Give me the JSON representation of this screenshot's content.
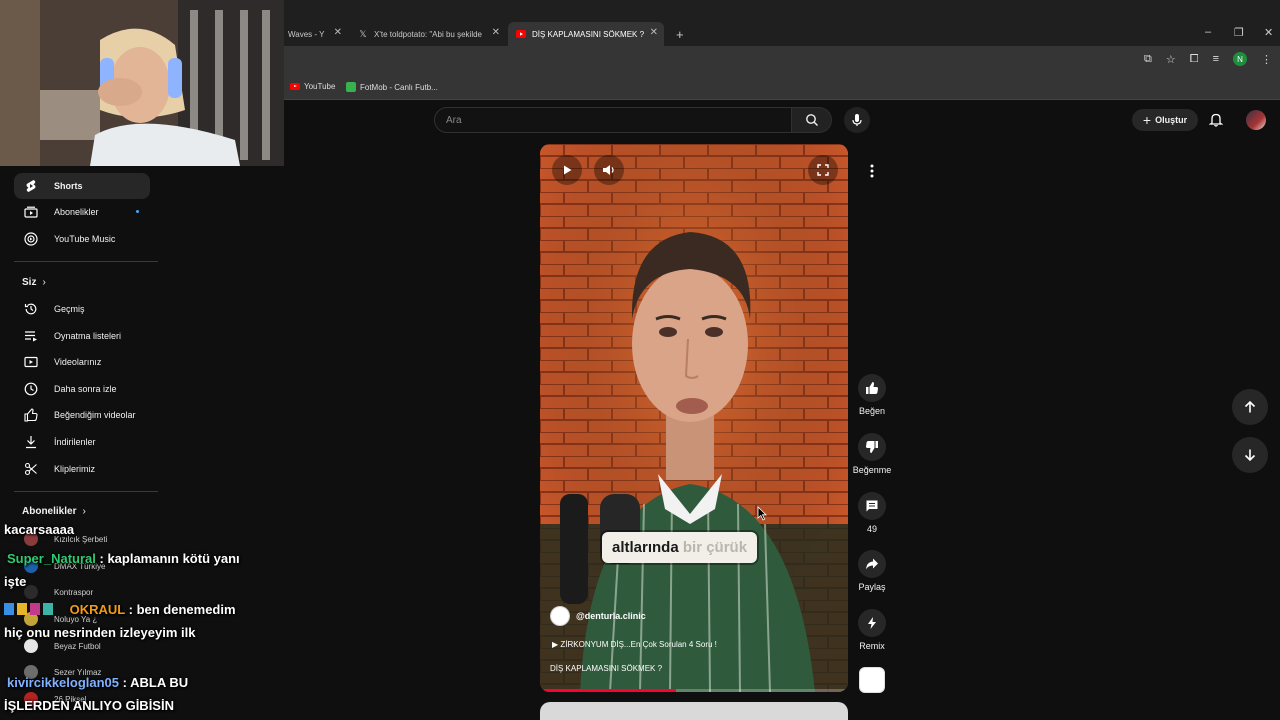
{
  "browser": {
    "tabs": [
      {
        "label": "Waves - Y"
      },
      {
        "label": "X'te toldpotato: \"Abi bu şekilde"
      },
      {
        "label": "DİŞ KAPLAMASINI SÖKMEK ? -"
      }
    ],
    "new_tab": "+",
    "window_controls": {
      "minimize": "–",
      "restore": "❐",
      "close": "✕"
    },
    "profile_initial": "N",
    "bookmarks": [
      {
        "label": "YouTube"
      },
      {
        "label": "FotMob - Canlı Futb..."
      }
    ]
  },
  "topbar": {
    "search_placeholder": "Ara",
    "create_label": "Oluştur"
  },
  "sidebar": {
    "top_items": [
      {
        "label": "Shorts",
        "icon": "shorts-icon",
        "active": true
      },
      {
        "label": "Abonelikler",
        "icon": "subscriptions-icon"
      },
      {
        "label": "YouTube Music",
        "icon": "music-icon"
      }
    ],
    "you_header": "Siz",
    "you_items": [
      {
        "label": "Geçmiş",
        "icon": "history-icon"
      },
      {
        "label": "Oynatma listeleri",
        "icon": "playlists-icon"
      },
      {
        "label": "Videolarınız",
        "icon": "your-videos-icon"
      },
      {
        "label": "Daha sonra izle",
        "icon": "watch-later-icon"
      },
      {
        "label": "Beğendiğim videolar",
        "icon": "liked-icon"
      },
      {
        "label": "İndirilenler",
        "icon": "downloads-icon"
      },
      {
        "label": "Kliplerimiz",
        "icon": "clips-icon"
      }
    ],
    "subs_header": "Abonelikler",
    "subscriptions": [
      {
        "label": "Kızılcık Şerbeti"
      },
      {
        "label": "DMAX Türkiye"
      },
      {
        "label": "Kontraspor"
      },
      {
        "label": "Noluyo Ya ¿"
      },
      {
        "label": "Beyaz Futbol"
      },
      {
        "label": "Sezer Yılmaz"
      },
      {
        "label": "26 Piksel"
      }
    ]
  },
  "chat": [
    {
      "user": "",
      "message": "kacarsaaaa",
      "color": "#ffffff"
    },
    {
      "user": "Super_Natural",
      "message": ": kaplamanın kötü yanı işte",
      "color": "#2ecc71"
    },
    {
      "user": "OKRAUL",
      "message": ": ben denemedim hiç onu nesrinden izleyeyim ilk",
      "color": "#f39c12"
    },
    {
      "user": "kivircikkeloglan05",
      "message": ": ABLA BU İŞLERDEN ANLIYO GİBİSİN",
      "color": "#7fb2ff"
    }
  ],
  "short": {
    "caption_main": "altlarında ",
    "caption_highlight": "bir çürük",
    "channel": "@denturla.clinic",
    "playlist": "ZİRKONYUM DİŞ...En Çok Sorulan 4 Soru !",
    "title": "DİŞ KAPLAMASINI SÖKMEK ?",
    "progress": 0.44
  },
  "actions": {
    "like": "Beğen",
    "dislike": "Beğenme",
    "comments": "49",
    "share": "Paylaş",
    "remix": "Remix"
  },
  "colors": {
    "accent_red": "#ff0033",
    "background": "#0f0f0f",
    "brick": "#c8562a"
  }
}
